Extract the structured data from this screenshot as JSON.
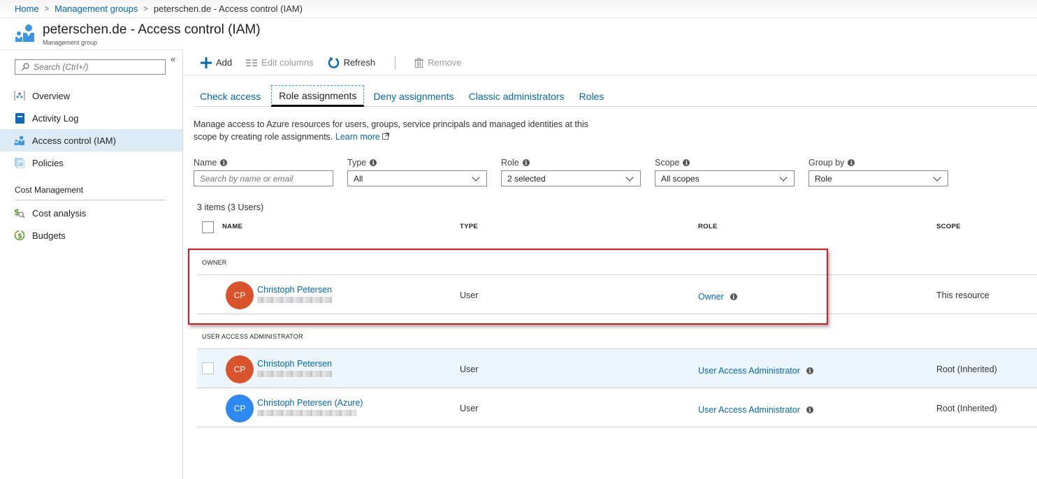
{
  "breadcrumb": {
    "items": [
      {
        "label": "Home",
        "link": true
      },
      {
        "label": "Management groups",
        "link": true
      },
      {
        "label": "peterschen.de - Access control (IAM)",
        "link": false
      }
    ]
  },
  "header": {
    "title": "peterschen.de - Access control (IAM)",
    "subtitle": "Management group",
    "icon": "iam-users-icon"
  },
  "sidebar": {
    "search_placeholder": "Search (Ctrl+/)",
    "collapse_label": "«",
    "items": [
      {
        "label": "Overview",
        "icon": "overview-icon",
        "active": false
      },
      {
        "label": "Activity Log",
        "icon": "activity-log-icon",
        "active": false
      },
      {
        "label": "Access control (IAM)",
        "icon": "iam-icon",
        "active": true
      },
      {
        "label": "Policies",
        "icon": "policies-icon",
        "active": false
      }
    ],
    "section_title": "Cost Management",
    "section_items": [
      {
        "label": "Cost analysis",
        "icon": "cost-analysis-icon"
      },
      {
        "label": "Budgets",
        "icon": "budgets-icon"
      }
    ]
  },
  "toolbar": {
    "add_label": "Add",
    "edit_columns_label": "Edit columns",
    "refresh_label": "Refresh",
    "remove_label": "Remove"
  },
  "tabs": [
    {
      "label": "Check access",
      "active": false
    },
    {
      "label": "Role assignments",
      "active": true
    },
    {
      "label": "Deny assignments",
      "active": false
    },
    {
      "label": "Classic administrators",
      "active": false
    },
    {
      "label": "Roles",
      "active": false
    }
  ],
  "description": {
    "text": "Manage access to Azure resources for users, groups, service principals and managed identities at this scope by creating role assignments.",
    "learn_more": "Learn more"
  },
  "filters": {
    "name": {
      "label": "Name",
      "placeholder": "Search by name or email",
      "value": ""
    },
    "type": {
      "label": "Type",
      "value": "All"
    },
    "role": {
      "label": "Role",
      "value": "2 selected"
    },
    "scope": {
      "label": "Scope",
      "value": "All scopes"
    },
    "group_by": {
      "label": "Group by",
      "value": "Role"
    }
  },
  "summary": "3 items (3 Users)",
  "table": {
    "columns": [
      "NAME",
      "TYPE",
      "ROLE",
      "SCOPE"
    ],
    "groups": [
      {
        "label": "OWNER",
        "rows": [
          {
            "initials": "CP",
            "avatar_color": "#d9532c",
            "name": "Christoph Petersen",
            "email": "(redacted)",
            "type": "User",
            "role": "Owner",
            "scope": "This resource"
          }
        ]
      },
      {
        "label": "USER ACCESS ADMINISTRATOR",
        "rows": [
          {
            "initials": "CP",
            "avatar_color": "#d9532c",
            "name": "Christoph Petersen",
            "email": "(redacted)",
            "type": "User",
            "role": "User Access Administrator",
            "scope": "Root (Inherited)"
          },
          {
            "initials": "CP",
            "avatar_color": "#2d89ef",
            "name": "Christoph Petersen (Azure)",
            "email": "(redacted)",
            "type": "User",
            "role": "User Access Administrator",
            "scope": "Root (Inherited)"
          }
        ]
      }
    ]
  },
  "colors": {
    "accent": "#0067b8",
    "active_nav_bg": "#ddebf7",
    "highlight_border": "#e8141b",
    "row_hover_bg": "#edf5fd"
  }
}
